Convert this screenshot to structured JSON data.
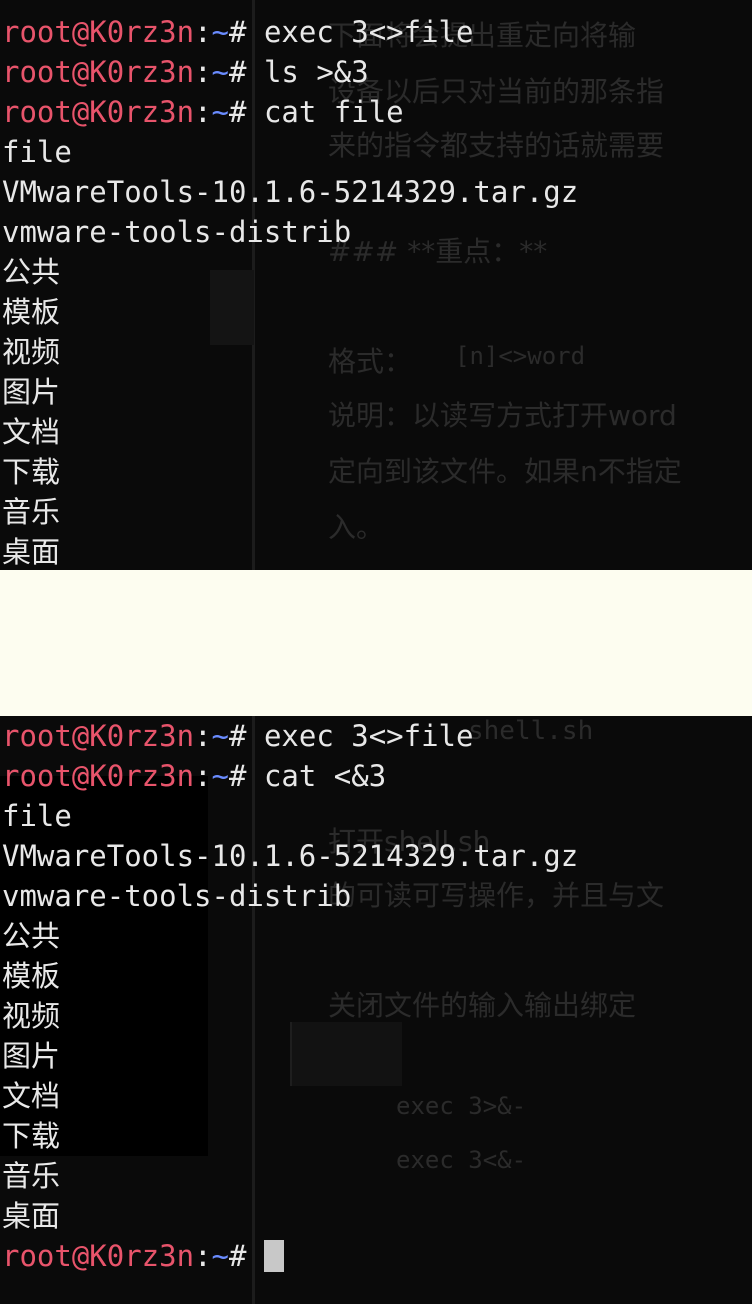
{
  "prompt": {
    "user_host": "root@K0rz3n",
    "colon": ":",
    "path": "~",
    "hash": "#"
  },
  "term1": {
    "commands": [
      "exec 3<>file",
      "ls >&3",
      "cat file"
    ],
    "output": [
      "file",
      "VMwareTools-10.1.6-5214329.tar.gz",
      "vmware-tools-distrib",
      "公共",
      "模板",
      "视频",
      "图片",
      "文档",
      "下载",
      "音乐",
      "桌面"
    ],
    "ghost": {
      "line1": "下面将会提出重定向将输",
      "line2": "设备以后只对当前的那条指",
      "line3": "来的指令都支持的话就需要",
      "heading": "### **重点：**",
      "format_label": "格式：",
      "format_value": "[n]<>word",
      "desc1": "说明：以读写方式打开word",
      "desc2": "定向到该文件。如果n不指定",
      "desc3": "入。"
    }
  },
  "term2": {
    "commands": [
      "exec 3<>file",
      "cat <&3"
    ],
    "output": [
      "file",
      "VMwareTools-10.1.6-5214329.tar.gz",
      "vmware-tools-distrib",
      "公共",
      "模板",
      "视频",
      "图片",
      "文档",
      "下载",
      "音乐",
      "桌面"
    ],
    "ghost": {
      "line1": "shell.sh",
      "line2": "打开shell.sh",
      "line3": "的可读可写操作，并且与文",
      "line4": "关闭文件的输入输出绑定",
      "code1": "exec 3>&-",
      "code2": "exec 3<&-"
    }
  }
}
